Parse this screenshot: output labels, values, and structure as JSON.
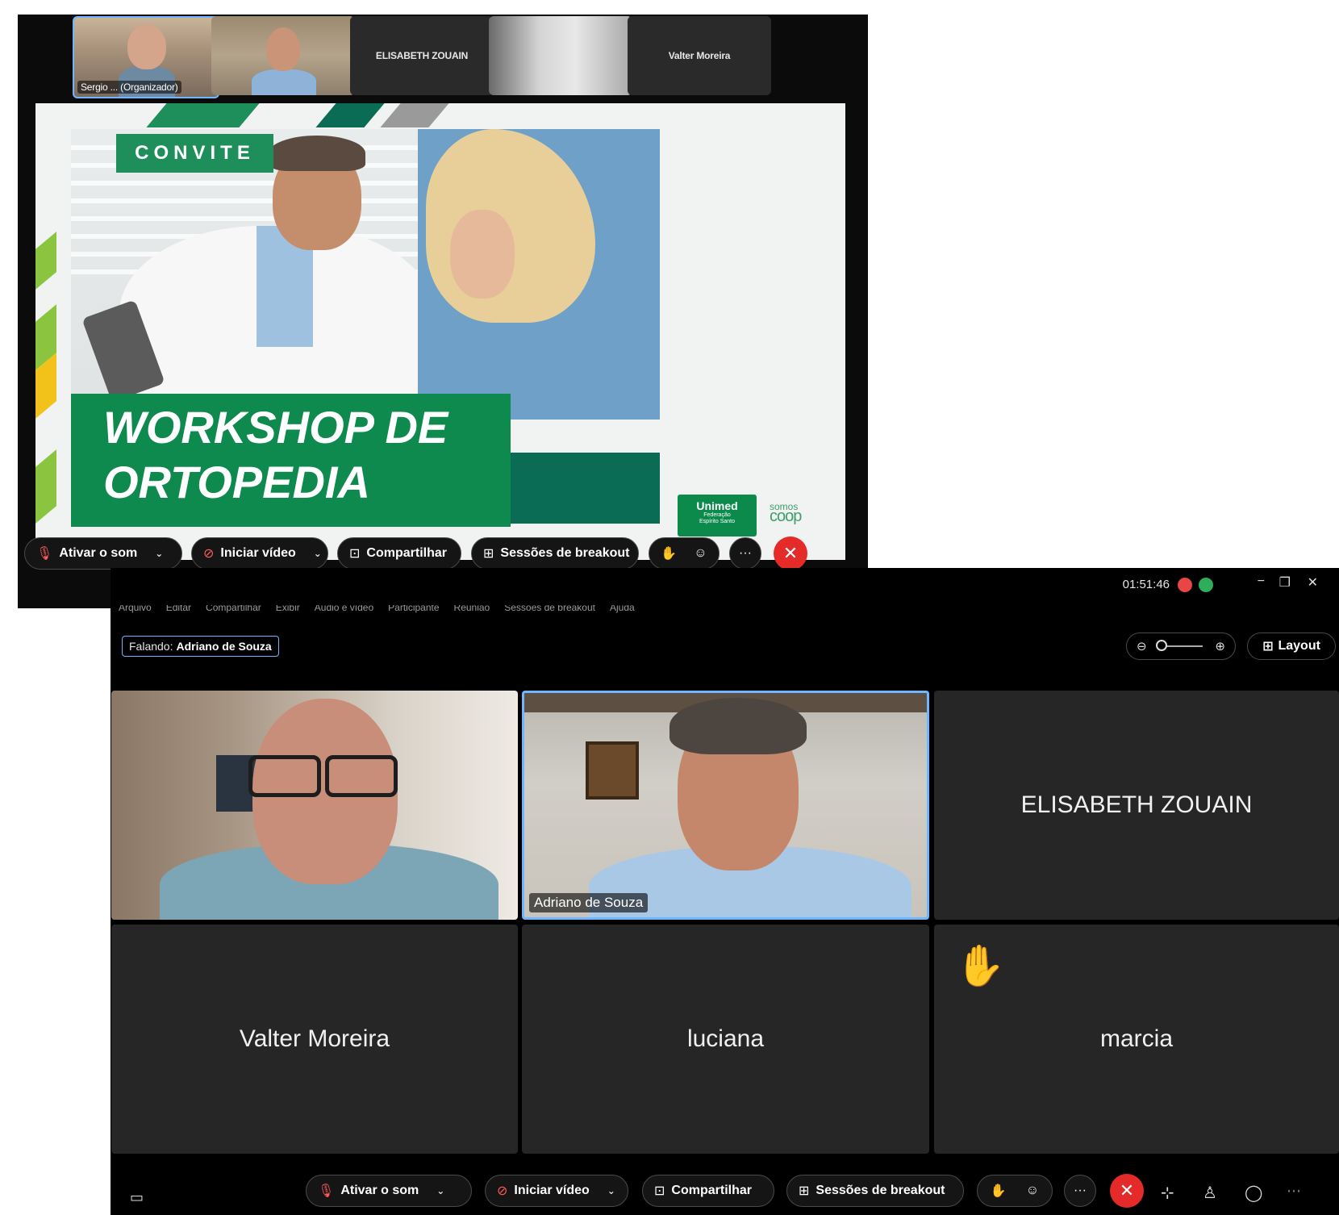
{
  "top_window": {
    "thumbnails": [
      {
        "label": "Sergio ... (Organizador)",
        "type": "video"
      },
      {
        "label": "",
        "type": "video"
      },
      {
        "label": "ELISABETH ZOUAIN",
        "type": "name"
      },
      {
        "label": "",
        "type": "video"
      },
      {
        "label": "Valter Moreira",
        "type": "name"
      }
    ],
    "slide": {
      "tag": "CONVITE",
      "title_line1": "WORKSHOP DE",
      "title_line2": "ORTOPEDIA",
      "logo_unimed": "Unimed",
      "logo_unimed_sub1": "Federação",
      "logo_unimed_sub2": "Espírito Santo",
      "logo_somos": "somos",
      "logo_coop": "coop"
    },
    "toolbar": {
      "unmute": "Ativar o som",
      "start_video": "Iniciar vídeo",
      "share": "Compartilhar",
      "breakout": "Sessões de breakout",
      "more": "···"
    }
  },
  "bottom_window": {
    "menu": [
      "Arquivo",
      "Editar",
      "Compartilhar",
      "Exibir",
      "Áudio e vídeo",
      "Participante",
      "Reunião",
      "Sessões de breakout",
      "Ajuda"
    ],
    "time": "01:51:46",
    "speaking_prefix": "Falando:",
    "speaking_name": "Adriano de Souza",
    "layout_label": "Layout",
    "tiles": [
      {
        "name": "",
        "type": "video"
      },
      {
        "name": "Adriano de Souza",
        "type": "video"
      },
      {
        "name": "ELISABETH ZOUAIN",
        "type": "name"
      },
      {
        "name": "Valter Moreira",
        "type": "name"
      },
      {
        "name": "luciana",
        "type": "name"
      },
      {
        "name": "marcia",
        "type": "name",
        "hand_raised": true
      }
    ],
    "toolbar": {
      "unmute": "Ativar o som",
      "start_video": "Iniciar vídeo",
      "share": "Compartilhar",
      "breakout": "Sessões de breakout",
      "more": "···"
    }
  },
  "colors": {
    "accent_blue": "#6fb5ff",
    "end_red": "#e52a2a",
    "unimed_green": "#0e8a4e",
    "tile_bg": "#262626"
  }
}
